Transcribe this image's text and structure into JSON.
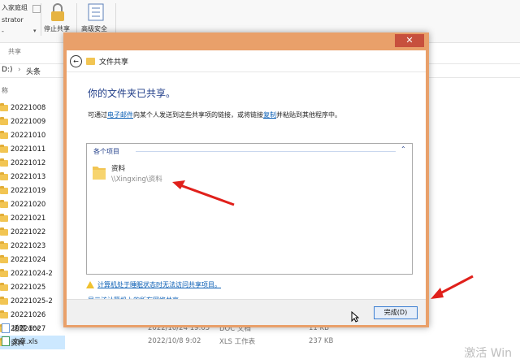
{
  "explorer": {
    "ribbon": {
      "partial_top": "入家庭组",
      "partial_mid": "strator",
      "partial_small": "-",
      "stop_share": "停止共享",
      "advanced_security": "高级安全",
      "group_label": "共享"
    },
    "address": {
      "drive": "D:)",
      "arrow": "›",
      "folder": "头条"
    },
    "column_name": "称",
    "folders": [
      "20221008",
      "20221009",
      "20221010",
      "20221011",
      "20221012",
      "20221013",
      "20221019",
      "20221020",
      "20221021",
      "20221022",
      "20221023",
      "20221024",
      "20221024-2",
      "20221025",
      "20221025-2",
      "20221026",
      "20221027",
      "资料"
    ],
    "selected_folder": "资料",
    "files": [
      {
        "name": "话题.doc",
        "date": "2022/10/24 19:05",
        "type": "DOC 文档",
        "size": "11 KB"
      },
      {
        "name": "文章.xls",
        "date": "2022/10/8 9:02",
        "type": "XLS 工作表",
        "size": "237 KB"
      }
    ]
  },
  "dialog": {
    "close_glyph": "✕",
    "title": "文件共享",
    "heading": "你的文件夹已共享。",
    "desc_pre": "可通过",
    "desc_email": "电子邮件",
    "desc_mid": "向某个人发送到这些共享项的链接，或将链接",
    "desc_copy": "复制",
    "desc_post": "并粘贴到其他程序中。",
    "items_header": "各个项目",
    "item_name": "资料",
    "item_path": "\\\\Xingxing\\资料",
    "sleep_warning": "计算机处于睡眠状态时无法访问共享项目。",
    "show_all": "显示该计算机上的所有网络共享。",
    "done_button": "完成(D)"
  },
  "watermark": "激活 Win",
  "colors": {
    "dialog_border": "#e9a06a",
    "close_button": "#c7503d",
    "heading": "#1f3c88",
    "link": "#0b5fb5",
    "arrow": "#e0201b"
  }
}
